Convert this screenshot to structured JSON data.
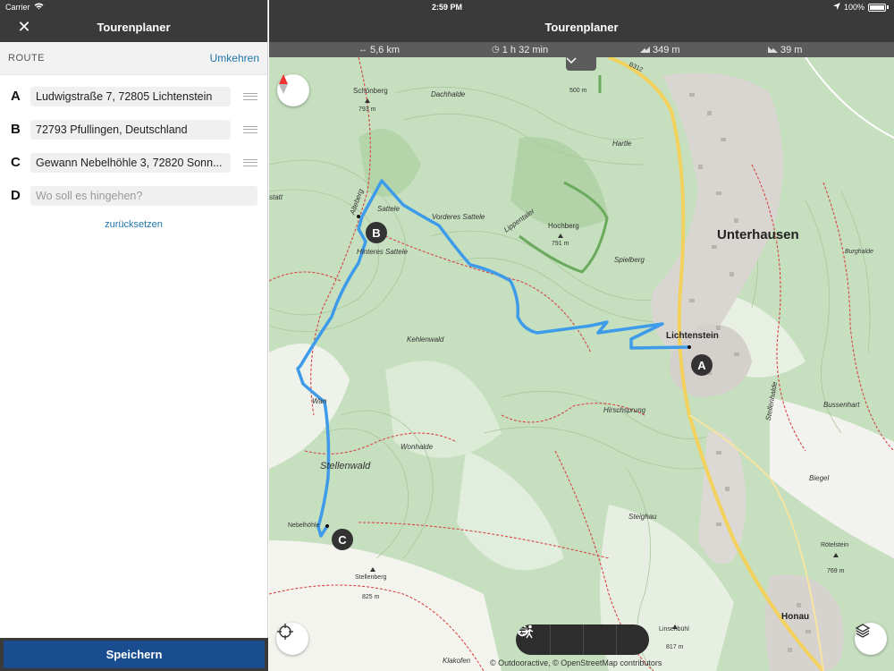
{
  "status_bar": {
    "carrier": "Carrier",
    "time": "2:59 PM",
    "battery": "100%"
  },
  "sidebar": {
    "title": "Tourenplaner",
    "route_label": "ROUTE",
    "reverse_label": "Umkehren",
    "stops": [
      {
        "letter": "A",
        "value": "Ludwigstraße 7, 72805 Lichtenstein"
      },
      {
        "letter": "B",
        "value": "72793 Pfullingen, Deutschland"
      },
      {
        "letter": "C",
        "value": "Gewann Nebelhöhle 3, 72820 Sonn..."
      },
      {
        "letter": "D",
        "placeholder": "Wo soll es hingehen?"
      }
    ],
    "reset_label": "zurücksetzen",
    "save_label": "Speichern"
  },
  "map": {
    "title": "Tourenplaner",
    "stats": {
      "distance": "5,6 km",
      "duration": "1 h 32 min",
      "ascent": "349 m",
      "descent": "39 m"
    },
    "attribution": "© Outdooractive, © OpenStreetMap contributors",
    "labels": {
      "unterhausen": "Unterhausen",
      "lichtenstein": "Lichtenstein",
      "honau": "Honau",
      "stellenwald": "Stellenwald",
      "schoenberg": "Schönberg",
      "schoenberg_elev": "793 m",
      "dachhalde": "Dachhalde",
      "hartle": "Hartle",
      "vorderes_sattele": "Vorderes Sattele",
      "sattele": "Sattele",
      "hinteres_sattele": "Hinteres Sattele",
      "hochberg": "Hochberg",
      "hochberg_elev": "791 m",
      "lippentaler": "Lippentaler",
      "spielberg": "Spielberg",
      "kehlenwald": "Kehlenwald",
      "wonhalde": "Wonhalde",
      "hirschsprung": "Hirschsprung",
      "steighau": "Steighau",
      "nebelhoehle": "Nebelhöhle",
      "stellenberg": "Stellenberg",
      "stellenberg_elev": "825 m",
      "biegel": "Biegel",
      "bussenhart": "Bussenhart",
      "roetelstein": "Rötelstein",
      "roetelstein_elev": "769 m",
      "linsenbuehl": "Linsenbühl",
      "linsenbuehl_elev": "817 m",
      "klakofen": "Klakofen",
      "alteberg": "Alteberg",
      "wan": "Wan",
      "statt": "statt",
      "elev_500": "500 m",
      "b312": "B312",
      "stellenhalde": "Stellenhalde",
      "burghalde": "Burghalde"
    },
    "markers": [
      "A",
      "B",
      "C"
    ],
    "colors": {
      "route": "#3d9be9",
      "path_red": "#d64545",
      "road_yellow": "#f2d15c",
      "forest": "#b9d8b0",
      "town": "#d8d5d0"
    }
  }
}
